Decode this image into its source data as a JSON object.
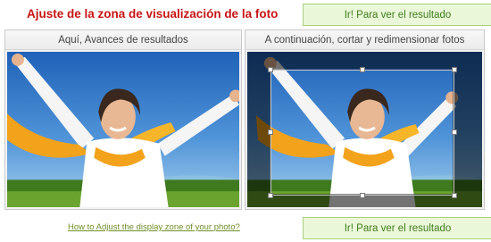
{
  "title": "Ajuste de la zona de visualización de la foto",
  "go_button_top": "Ir! Para ver el resultado",
  "go_button_bottom": "Ir! Para ver el resultado",
  "left_panel": {
    "header": "Aquí, Avances de resultados"
  },
  "right_panel": {
    "header": "A continuación, cortar y redimensionar fotos"
  },
  "help_link": "How to Adjust the display zone of your photo?",
  "colors": {
    "title": "#c81414",
    "button_bg": "#eaf7d8",
    "button_text": "#3f7f1c",
    "link": "#6f8f2a"
  }
}
